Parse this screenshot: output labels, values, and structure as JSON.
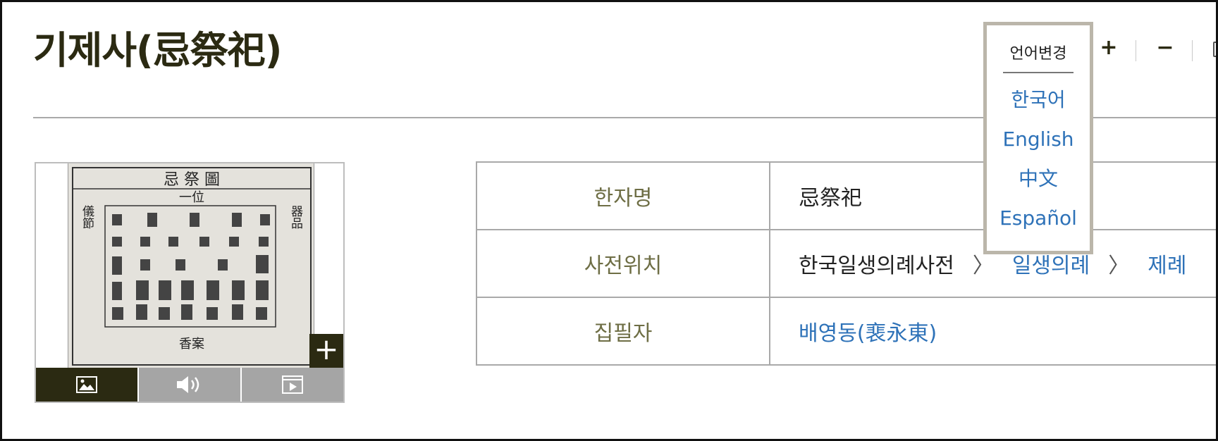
{
  "page": {
    "title": "기제사(忌祭祀)"
  },
  "tools": {
    "zoom_in": "+",
    "zoom_out": "−"
  },
  "language_menu": {
    "header": "언어변경",
    "options": [
      "한국어",
      "English",
      "中文",
      "Español"
    ]
  },
  "media": {
    "zoom_label": "+",
    "chart_heading": "忌  祭  圖",
    "chart_subheading": "一位",
    "chart_side_left": "儀節",
    "chart_side_right": "器品",
    "chart_footer": "香案",
    "tabs": [
      {
        "icon": "image-icon",
        "active": true
      },
      {
        "icon": "audio-icon",
        "active": false
      },
      {
        "icon": "video-icon",
        "active": false
      }
    ]
  },
  "info": {
    "rows": [
      {
        "label": "한자명",
        "value": "忌祭祀"
      },
      {
        "label": "사전위치",
        "breadcrumb": [
          "한국일생의례사전",
          "일생의례",
          "제례"
        ],
        "separator": "〉"
      },
      {
        "label": "집필자",
        "value": "배영동(裵永東)"
      }
    ]
  },
  "colors": {
    "title": "#2b2a12",
    "label": "#6e6e45",
    "link": "#2e72b8",
    "active_tab": "#2b2a12",
    "inactive_tab": "#a5a5a5"
  }
}
